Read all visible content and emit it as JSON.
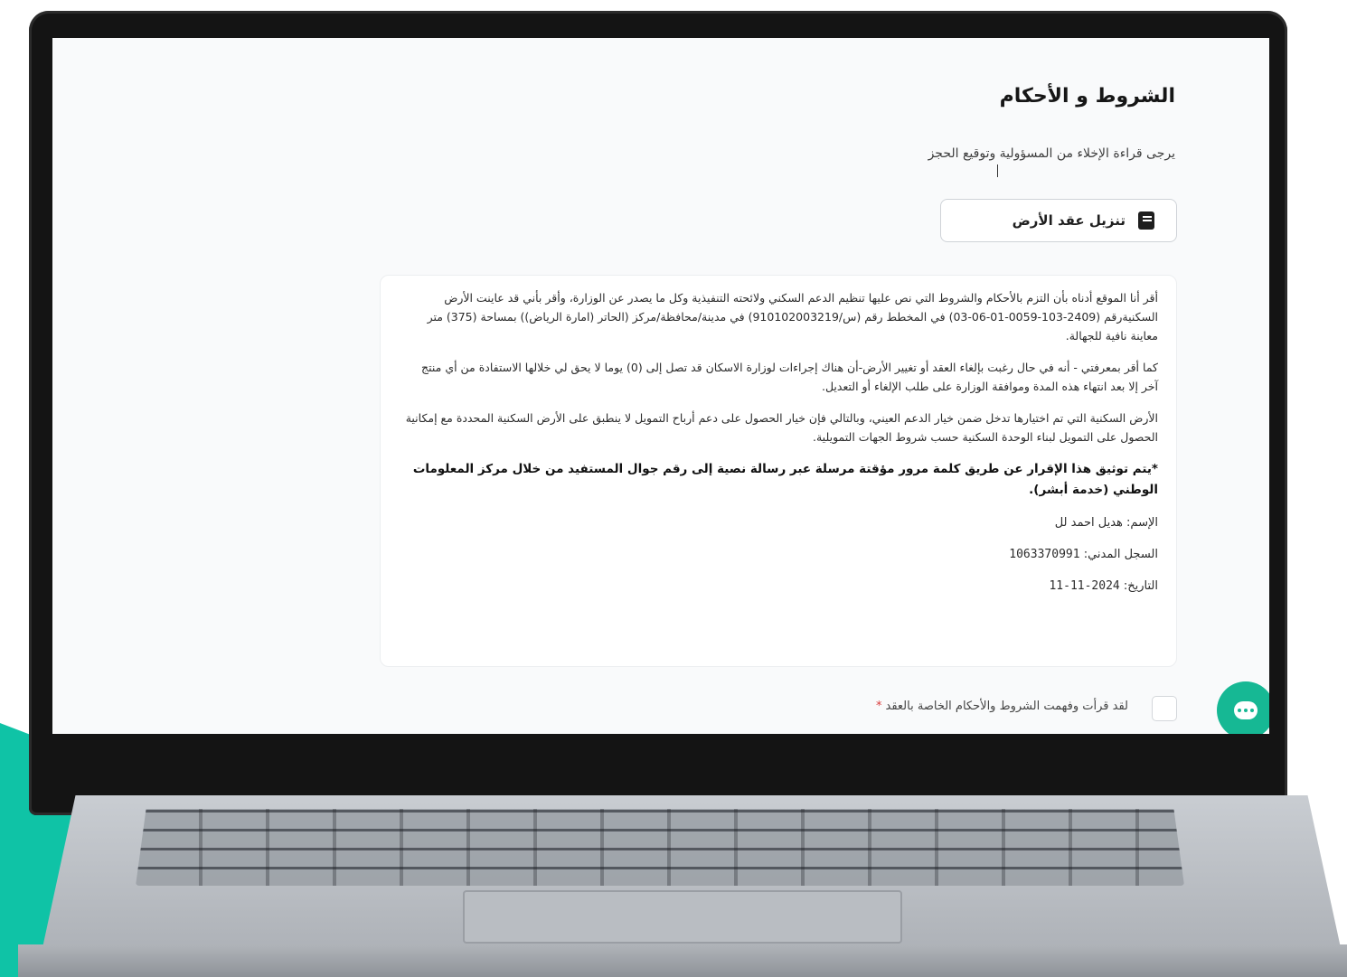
{
  "page": {
    "title": "الشروط و الأحكام",
    "subtitle": "يرجى قراءة الإخلاء من المسؤولية وتوقيع الحجز"
  },
  "download": {
    "label": "تنزيل عقد الأرض",
    "icon": "document-icon"
  },
  "terms": {
    "paragraph_1": "أقر أنا الموقع أدناه بأن التزم بالأحكام والشروط التي نص عليها تنظيم الدعم السكني ولائحته التنفيذية وكل ما يصدر عن الوزارة، وأقر بأني قد عاينت الأرض السكنيةرقم (2409-103-0059-01-06-03) في المخطط رقم (س/910102003219) في مدينة/محافظة/مركز (الحاتر (امارة الرياض)) بمساحة (375) متر معاينة نافية للجهالة.",
    "paragraph_2": "كما أقر بمعرفتي - أنه في حال رغبت بإلغاء العقد أو تغيير الأرض-أن هناك إجراءات لوزارة الاسكان قد تصل إلى (0) يوما لا يحق لي خلالها الاستفادة من أي منتج آخر إلا بعد انتهاء هذه المدة وموافقة الوزارة على طلب الإلغاء أو التعديل.",
    "paragraph_3": "الأرض السكنية التي تم اختيارها تدخل ضمن خيار الدعم العيني، وبالتالي فإن خيار الحصول على دعم أرباح التمويل لا ينطبق على الأرض السكنية المحددة مع إمكانية الحصول على التمويل لبناء الوحدة السكنية حسب شروط الجهات التمويلية.",
    "notice": "*يتم توثيق هذا الإقرار عن طريق كلمة مرور مؤقتة مرسلة عبر رسالة نصية إلى رقم جوال المستفيد من خلال مركز المعلومات الوطني (خدمة أبشر).",
    "name_label": "الإسم:",
    "name_value": "هديل احمد لل",
    "civil_label": "السجل المدني:",
    "civil_value": "1063370991",
    "date_label": "التاريخ:",
    "date_value": "2024-11-11"
  },
  "agreement": {
    "label": "لقد قرأت وفهمت الشروط والأحكام الخاصة بالعقد",
    "required_mark": "*"
  },
  "chat": {
    "icon": "chat-icon",
    "color": "#16b894"
  },
  "colors": {
    "accent": "#0fc3a6",
    "bezel": "#141414",
    "screen_bg": "#f9fafb"
  }
}
